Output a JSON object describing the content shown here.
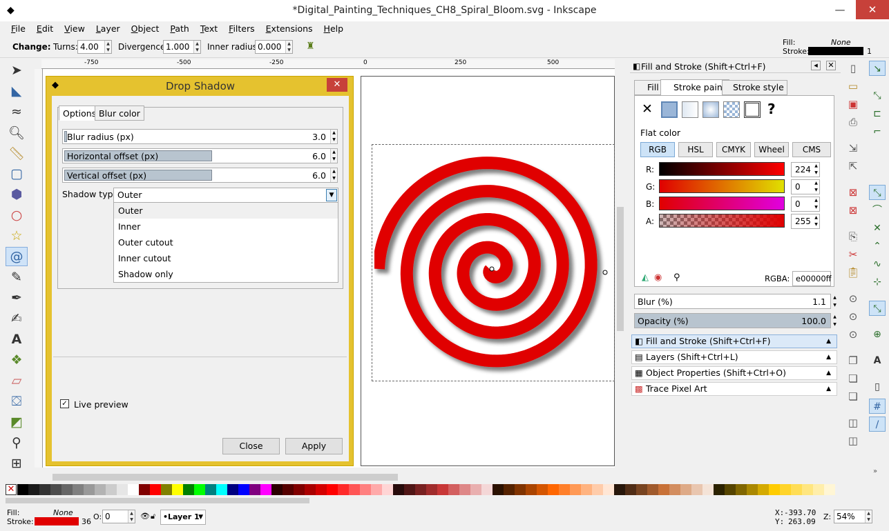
{
  "window": {
    "title": "*Digital_Painting_Techniques_CH8_Spiral_Bloom.svg - Inkscape"
  },
  "menu": [
    "File",
    "Edit",
    "View",
    "Layer",
    "Object",
    "Path",
    "Text",
    "Filters",
    "Extensions",
    "Help"
  ],
  "toolctl": {
    "change": "Change:",
    "turns_label": "Turns:",
    "turns": "4.00",
    "divergence_label": "Divergence:",
    "divergence": "1.000",
    "inner_label": "Inner radius:",
    "inner": "0.000"
  },
  "topstyle": {
    "fill_label": "Fill:",
    "fill": "None",
    "stroke_label": "Stroke:",
    "stroke_width": "1"
  },
  "ruler": [
    "-750",
    "-500",
    "-250",
    "0",
    "250",
    "500"
  ],
  "dialog": {
    "title": "Drop Shadow",
    "tabs": [
      "Options",
      "Blur color"
    ],
    "blur_label": "Blur radius (px)",
    "blur": "3.0",
    "hoff_label": "Horizontal offset (px)",
    "hoff": "6.0",
    "voff_label": "Vertical offset (px)",
    "voff": "6.0",
    "shadow_type_label": "Shadow type:",
    "shadow_type": "Outer",
    "options": [
      "Outer",
      "Inner",
      "Outer cutout",
      "Inner cutout",
      "Shadow only"
    ],
    "live_preview": "Live preview",
    "close": "Close",
    "apply": "Apply"
  },
  "fillstroke": {
    "header": "Fill and Stroke (Shift+Ctrl+F)",
    "tabs": [
      "Fill",
      "Stroke paint",
      "Stroke style"
    ],
    "flat_color": "Flat color",
    "modes": [
      "RGB",
      "HSL",
      "CMYK",
      "Wheel",
      "CMS"
    ],
    "channels": [
      {
        "label": "R:",
        "value": "224"
      },
      {
        "label": "G:",
        "value": "0"
      },
      {
        "label": "B:",
        "value": "0"
      },
      {
        "label": "A:",
        "value": "255"
      }
    ],
    "rgba_label": "RGBA:",
    "rgba": "e00000ff",
    "blur_label": "Blur (%)",
    "blur": "1.1",
    "opacity_label": "Opacity (%)",
    "opacity": "100.0"
  },
  "docks": [
    "Fill and Stroke (Shift+Ctrl+F)",
    "Layers (Shift+Ctrl+L)",
    "Object Properties (Shift+Ctrl+O)",
    "Trace Pixel Art"
  ],
  "status": {
    "fill_label": "Fill:",
    "fill": "None",
    "stroke_label": "Stroke:",
    "stroke_width": "36",
    "o_label": "O:",
    "opacity": "0",
    "layer": "•Layer 1",
    "x_label": "X:",
    "x": "-393.70",
    "y_label": "Y:",
    "y": "263.09",
    "z_label": "Z:",
    "zoom": "54%"
  },
  "colors": {
    "accent": "#e00000",
    "dialog_frame": "#e5c22f"
  }
}
